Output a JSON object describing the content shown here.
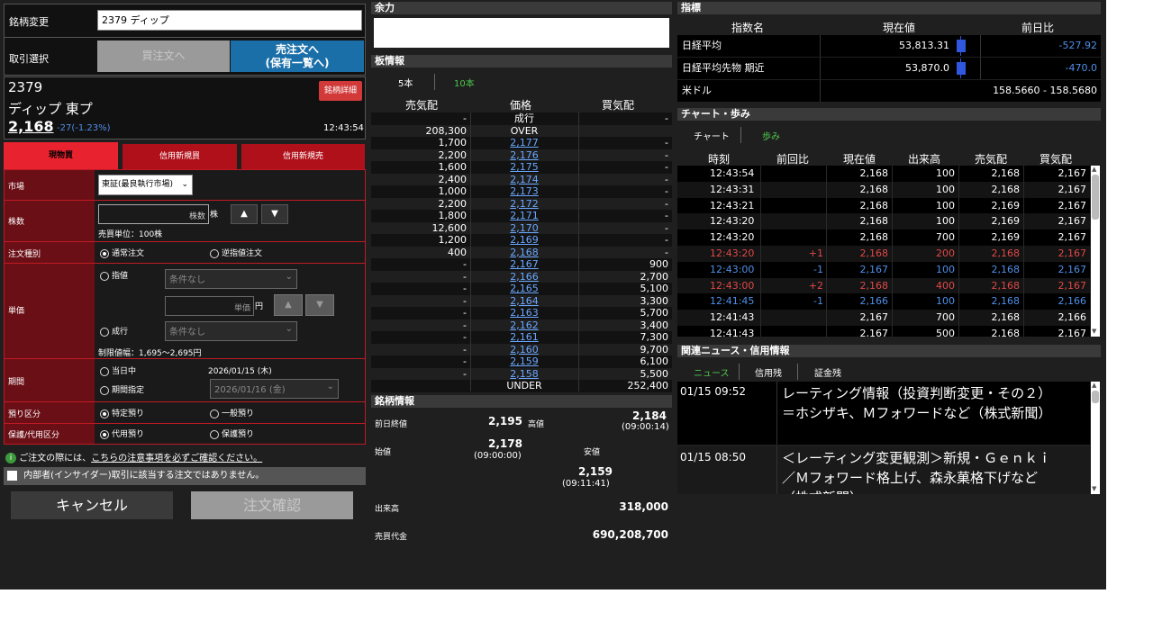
{
  "order": {
    "symbol_label": "銘柄変更",
    "symbol_value": "2379 ディップ",
    "trade_label": "取引選択",
    "buy_button": "買注文へ",
    "sell_button_line1": "売注文へ",
    "sell_button_line2": "(保有一覧へ)",
    "code": "2379",
    "name": "ディップ 東プ",
    "price": "2,168",
    "change": "-27(-1.23%)",
    "time": "12:43:54",
    "detail_button": "銘柄詳細",
    "tabs": [
      "現物買",
      "信用新規買",
      "信用新規売"
    ],
    "market_label": "市場",
    "market_value": "東証(最良執行市場)",
    "qty_label": "株数",
    "qty_placeholder": "株数",
    "qty_unit": "株",
    "trade_unit": "売買単位：100株",
    "order_type_label": "注文種別",
    "order_type_normal": "通常注文",
    "order_type_stop": "逆指値注文",
    "price_label": "単価",
    "limit_label": "指値",
    "cond_none": "条件なし",
    "price_placeholder": "単価",
    "yen": "円",
    "market_order_label": "成行",
    "price_range": "制限値幅：1,695〜2,695円",
    "period_label": "期間",
    "period_today": "当日中",
    "period_today_date": "2026/01/15 (木)",
    "period_specify": "期間指定",
    "period_date": "2026/01/16 (金)",
    "deposit_label": "預り区分",
    "deposit_specific": "特定預り",
    "deposit_general": "一般預り",
    "margin_label": "保護/代用区分",
    "margin_sub": "代用預り",
    "margin_protect": "保護預り",
    "notice_prefix": "ご注文の際には、",
    "notice_link": "こちらの注意事項を必ずご確認ください。",
    "insider": "内部者(インサイダー)取引に該当する注文ではありません。",
    "cancel_button": "キャンセル",
    "confirm_button": "注文確認"
  },
  "board": {
    "yoryoku_header": "余力",
    "board_header": "板情報",
    "tab5": "5本",
    "tab10": "10本",
    "col_sell": "売気配",
    "col_price": "価格",
    "col_buy": "買気配",
    "rows": [
      {
        "sell": "-",
        "price": "成行",
        "buy": "-",
        "link": false
      },
      {
        "sell": "208,300",
        "price": "OVER",
        "buy": "",
        "link": false
      },
      {
        "sell": "1,700",
        "price": "2,177",
        "buy": "-",
        "link": true
      },
      {
        "sell": "2,200",
        "price": "2,176",
        "buy": "-",
        "link": true
      },
      {
        "sell": "1,600",
        "price": "2,175",
        "buy": "-",
        "link": true
      },
      {
        "sell": "2,400",
        "price": "2,174",
        "buy": "-",
        "link": true
      },
      {
        "sell": "1,000",
        "price": "2,173",
        "buy": "-",
        "link": true
      },
      {
        "sell": "2,200",
        "price": "2,172",
        "buy": "-",
        "link": true
      },
      {
        "sell": "1,800",
        "price": "2,171",
        "buy": "-",
        "link": true
      },
      {
        "sell": "12,600",
        "price": "2,170",
        "buy": "-",
        "link": true
      },
      {
        "sell": "1,200",
        "price": "2,169",
        "buy": "-",
        "link": true
      },
      {
        "sell": "400",
        "price": "2,168",
        "buy": "-",
        "link": true
      },
      {
        "sell": "-",
        "price": "2,167",
        "buy": "900",
        "link": true
      },
      {
        "sell": "-",
        "price": "2,166",
        "buy": "2,700",
        "link": true
      },
      {
        "sell": "-",
        "price": "2,165",
        "buy": "5,100",
        "link": true
      },
      {
        "sell": "-",
        "price": "2,164",
        "buy": "3,300",
        "link": true
      },
      {
        "sell": "-",
        "price": "2,163",
        "buy": "5,700",
        "link": true
      },
      {
        "sell": "-",
        "price": "2,162",
        "buy": "3,400",
        "link": true
      },
      {
        "sell": "-",
        "price": "2,161",
        "buy": "7,300",
        "link": true
      },
      {
        "sell": "-",
        "price": "2,160",
        "buy": "9,700",
        "link": true
      },
      {
        "sell": "-",
        "price": "2,159",
        "buy": "6,100",
        "link": true
      },
      {
        "sell": "-",
        "price": "2,158",
        "buy": "5,500",
        "link": true
      },
      {
        "sell": "",
        "price": "UNDER",
        "buy": "252,400",
        "link": false
      }
    ],
    "info_header": "銘柄情報",
    "prev_close_label": "前日終値",
    "prev_close": "2,195",
    "high_label": "高値",
    "high": "2,184",
    "high_time": "(09:00:14)",
    "open_label": "始値",
    "open": "2,178",
    "open_time": "(09:00:00)",
    "low_label": "安値",
    "low": "2,159",
    "low_time": "(09:11:41)",
    "volume_label": "出来高",
    "volume": "318,000",
    "turnover_label": "売買代金",
    "turnover": "690,208,700"
  },
  "indices": {
    "header": "指標",
    "col_name": "指数名",
    "col_price": "現在値",
    "col_change": "前日比",
    "rows": [
      {
        "name": "日経平均",
        "price": "53,813.31",
        "change": "-527.92",
        "bar": true
      },
      {
        "name": "日経平均先物 期近",
        "price": "53,870.0",
        "change": "-470.0",
        "bar": true
      },
      {
        "name": "米ドル",
        "price": "",
        "change": "158.5660 - 158.5680",
        "bar": false
      }
    ]
  },
  "ticks": {
    "header": "チャート・歩み",
    "tab_chart": "チャート",
    "tab_ayumi": "歩み",
    "cols": [
      "時刻",
      "前回比",
      "現在値",
      "出来高",
      "売気配",
      "買気配"
    ],
    "rows": [
      {
        "time": "12:43:54",
        "diff": "",
        "price": "2,168",
        "vol": "100",
        "ask": "2,168",
        "bid": "2,167",
        "color": "white"
      },
      {
        "time": "12:43:31",
        "diff": "",
        "price": "2,168",
        "vol": "100",
        "ask": "2,168",
        "bid": "2,167",
        "color": "white"
      },
      {
        "time": "12:43:21",
        "diff": "",
        "price": "2,168",
        "vol": "100",
        "ask": "2,169",
        "bid": "2,167",
        "color": "white"
      },
      {
        "time": "12:43:20",
        "diff": "",
        "price": "2,168",
        "vol": "100",
        "ask": "2,169",
        "bid": "2,167",
        "color": "white"
      },
      {
        "time": "12:43:20",
        "diff": "",
        "price": "2,168",
        "vol": "700",
        "ask": "2,169",
        "bid": "2,167",
        "color": "white"
      },
      {
        "time": "12:43:20",
        "diff": "+1",
        "price": "2,168",
        "vol": "200",
        "ask": "2,168",
        "bid": "2,167",
        "color": "red"
      },
      {
        "time": "12:43:00",
        "diff": "-1",
        "price": "2,167",
        "vol": "100",
        "ask": "2,168",
        "bid": "2,167",
        "color": "blue"
      },
      {
        "time": "12:43:00",
        "diff": "+2",
        "price": "2,168",
        "vol": "400",
        "ask": "2,168",
        "bid": "2,167",
        "color": "red"
      },
      {
        "time": "12:41:45",
        "diff": "-1",
        "price": "2,166",
        "vol": "100",
        "ask": "2,168",
        "bid": "2,166",
        "color": "blue"
      },
      {
        "time": "12:41:43",
        "diff": "",
        "price": "2,167",
        "vol": "700",
        "ask": "2,168",
        "bid": "2,166",
        "color": "white"
      },
      {
        "time": "12:41:43",
        "diff": "",
        "price": "2,167",
        "vol": "500",
        "ask": "2,168",
        "bid": "2,167",
        "color": "white"
      }
    ]
  },
  "news": {
    "header": "関連ニュース・信用情報",
    "tabs": [
      "ニュース",
      "信用残",
      "証金残"
    ],
    "items": [
      {
        "time": "01/15 09:52",
        "text": "レーティング情報（投資判断変更・その２）＝ホシザキ、Ｍフォワードなど（株式新聞）"
      },
      {
        "time": "01/15 08:50",
        "text": "＜レーティング変更観測＞新規・Ｇｅｎｋｉ／Ｍフォワード格上げ、森永菓格下げなど（株式新聞）"
      }
    ]
  }
}
